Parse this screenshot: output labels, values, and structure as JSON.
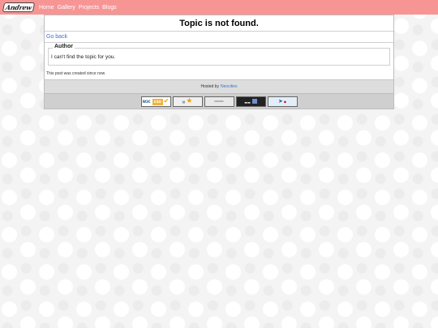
{
  "header": {
    "logo_text": "Andrew",
    "nav": [
      "Home",
      "Gallery",
      "Projects",
      "Blogs"
    ]
  },
  "main": {
    "title": "Topic is not found.",
    "back_link": "Go back",
    "author_legend": "Author",
    "message": "I can't find the topic for you.",
    "created": "This post was created since now"
  },
  "footer": {
    "hosted_prefix": "Hosted by",
    "hosted_link": "Neocities",
    "badges": [
      {
        "name": "w3c-css-badge",
        "icon": "w3c-css-icon"
      },
      {
        "name": "hosted-by-neocities-badge",
        "icon": "neocities-star-icon"
      },
      {
        "name": "get-firefox-badge",
        "icon": "firefox-icon"
      },
      {
        "name": "microsoft-ie-badge",
        "icon": "ie-icon"
      },
      {
        "name": "new-badge",
        "icon": "new-arrow-icon"
      }
    ]
  },
  "colors": {
    "topbar": "#f79595",
    "link": "#3b74c9",
    "footer_gray": "#dddddd"
  }
}
